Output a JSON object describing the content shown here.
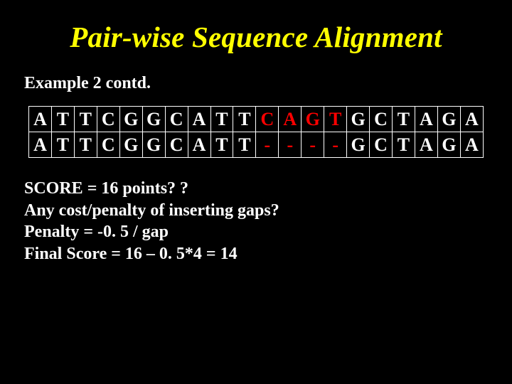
{
  "title": "Pair-wise Sequence Alignment",
  "subtitle": "Example 2 contd.",
  "alignment": {
    "gap_columns": [
      10,
      11,
      12,
      13
    ],
    "rows": [
      [
        "A",
        "T",
        "T",
        "C",
        "G",
        "G",
        "C",
        "A",
        "T",
        "T",
        "C",
        "A",
        "G",
        "T",
        "G",
        "C",
        "T",
        "A",
        "G",
        "A"
      ],
      [
        "A",
        "T",
        "T",
        "C",
        "G",
        "G",
        "C",
        "A",
        "T",
        "T",
        "-",
        "-",
        "-",
        "-",
        "G",
        "C",
        "T",
        "A",
        "G",
        "A"
      ]
    ]
  },
  "body": {
    "line1": "SCORE = 16 points? ?",
    "line2": "Any cost/penalty of inserting gaps?",
    "line3": "Penalty = -0. 5 / gap",
    "line4": "Final Score = 16 – 0. 5*4 = 14"
  }
}
